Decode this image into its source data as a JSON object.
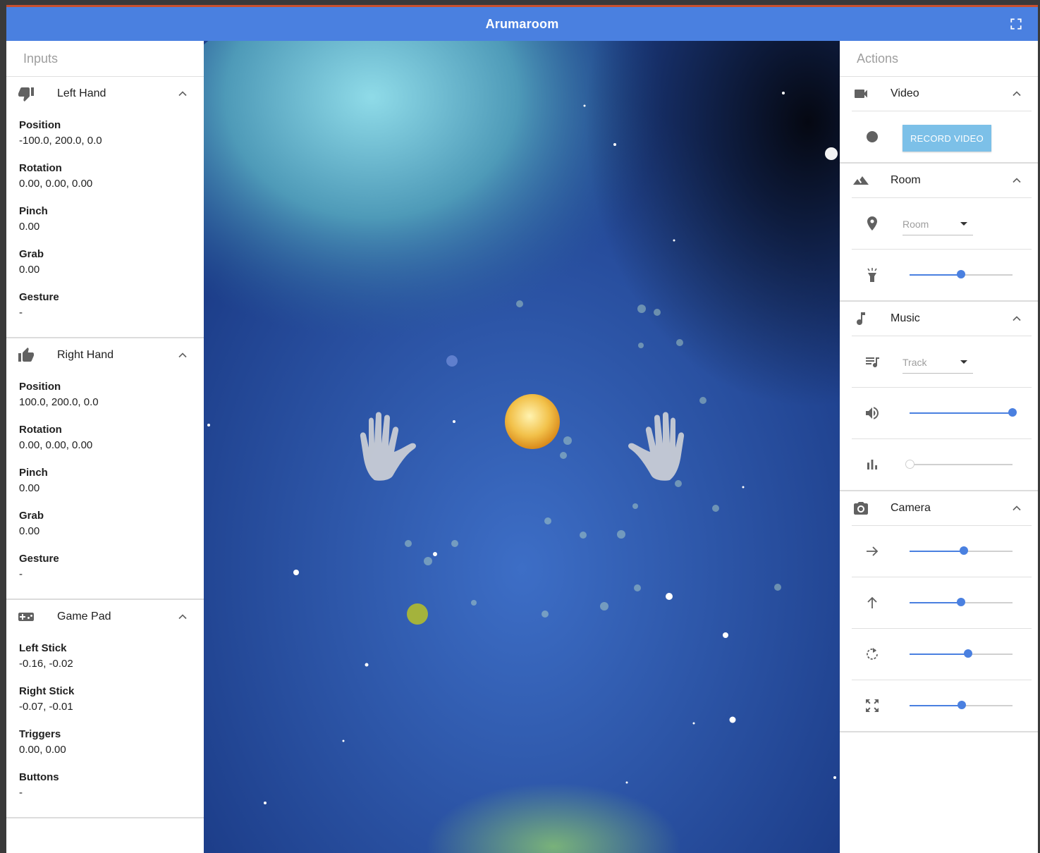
{
  "app": {
    "title": "Arumaroom"
  },
  "inputs": {
    "header": "Inputs",
    "left_hand": {
      "title": "Left Hand",
      "fields": [
        {
          "label": "Position",
          "value": "-100.0, 200.0, 0.0"
        },
        {
          "label": "Rotation",
          "value": "0.00, 0.00, 0.00"
        },
        {
          "label": "Pinch",
          "value": "0.00"
        },
        {
          "label": "Grab",
          "value": "0.00"
        },
        {
          "label": "Gesture",
          "value": "-"
        }
      ]
    },
    "right_hand": {
      "title": "Right Hand",
      "fields": [
        {
          "label": "Position",
          "value": "100.0, 200.0, 0.0"
        },
        {
          "label": "Rotation",
          "value": "0.00, 0.00, 0.00"
        },
        {
          "label": "Pinch",
          "value": "0.00"
        },
        {
          "label": "Grab",
          "value": "0.00"
        },
        {
          "label": "Gesture",
          "value": "-"
        }
      ]
    },
    "game_pad": {
      "title": "Game Pad",
      "fields": [
        {
          "label": "Left Stick",
          "value": "-0.16, -0.02"
        },
        {
          "label": "Right Stick",
          "value": "-0.07, -0.01"
        },
        {
          "label": "Triggers",
          "value": "0.00, 0.00"
        },
        {
          "label": "Buttons",
          "value": "-"
        }
      ]
    }
  },
  "actions": {
    "header": "Actions",
    "video": {
      "title": "Video",
      "record_label": "RECORD VIDEO"
    },
    "room": {
      "title": "Room",
      "select_value": "Room",
      "light_level": 0.5
    },
    "music": {
      "title": "Music",
      "select_value": "Track",
      "volume_level": 1.0,
      "equalizer_level": 0.0
    },
    "camera": {
      "title": "Camera",
      "x_level": 0.53,
      "y_level": 0.5,
      "rotate_level": 0.57,
      "zoom_level": 0.51
    }
  },
  "colors": {
    "appbar": "#4a80e0",
    "accent": "#4a80e0",
    "record_button": "#7cc0e8"
  }
}
